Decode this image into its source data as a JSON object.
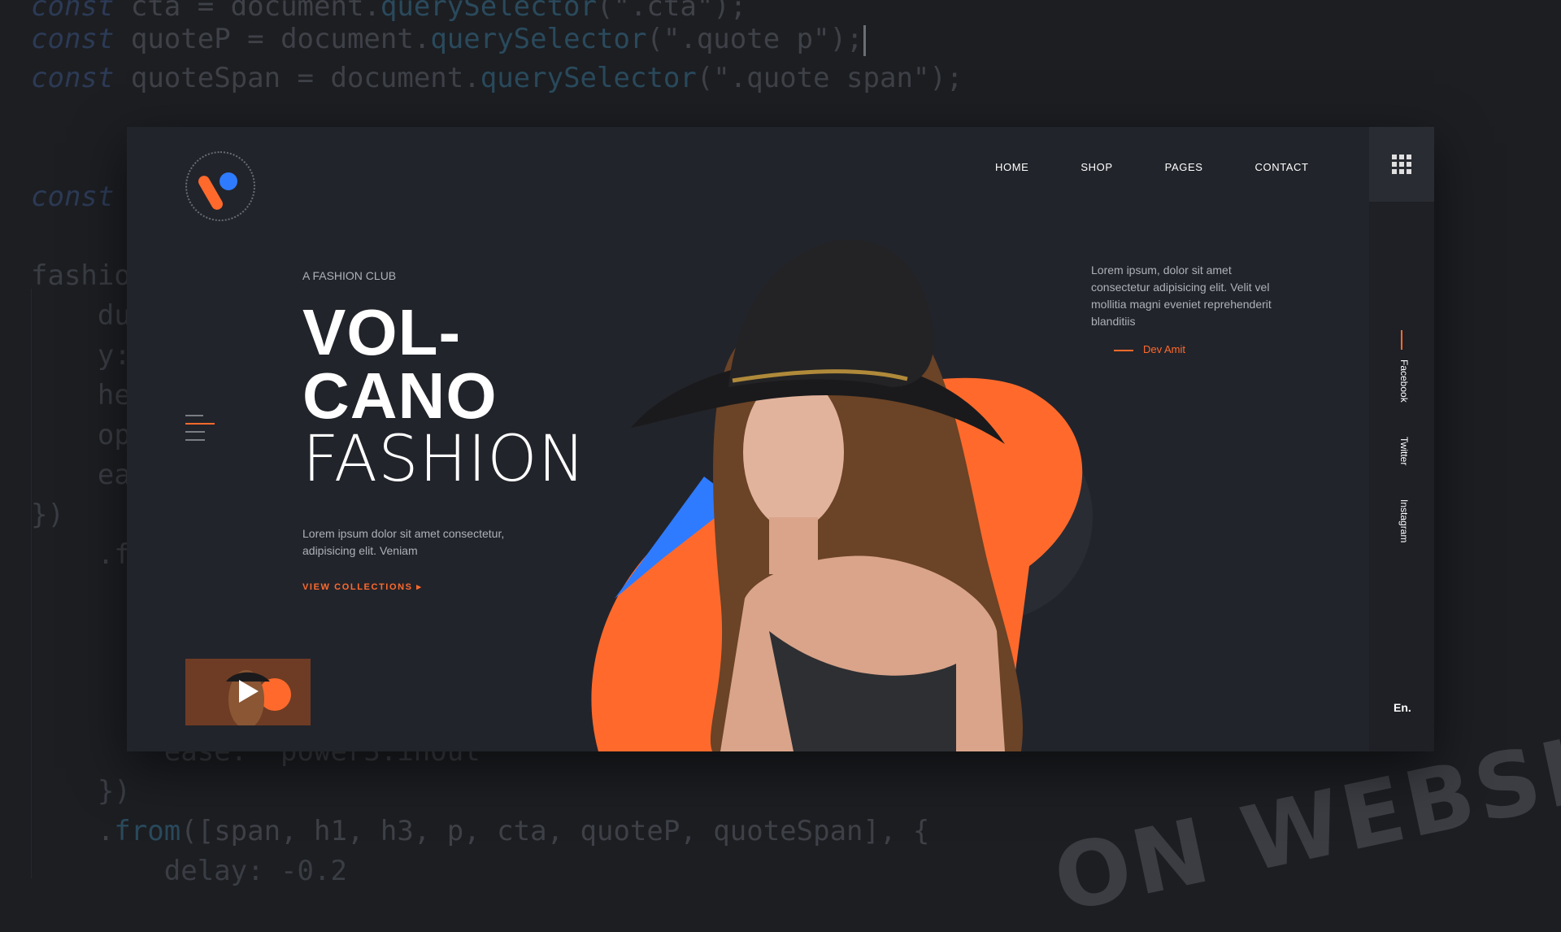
{
  "code": {
    "lines": [
      "const cta = document.querySelector(\".cta\");",
      "const quoteP = document.querySelector(\".quote p\");",
      "const quoteSpan = document.querySelector(\".quote span\");",
      "",
      "const",
      "",
      "fashio",
      "    du",
      "    y:",
      "    he",
      "    op",
      "    ea",
      "})",
      "    .f",
      "",
      "",
      "",
      "",
      "",
      "        ease: \"power3.inOut\"",
      "    })",
      "    .from([span, h1, h3, p, cta, quoteP, quoteSpan], {",
      "        delay: -0.2"
    ]
  },
  "watermark": "ON WEBSITE",
  "site": {
    "nav": [
      "HOME",
      "SHOP",
      "PAGES",
      "CONTACT"
    ],
    "eyebrow": "A FASHION CLUB",
    "headline": {
      "line1": "VOL-",
      "line2": "CANO",
      "line3": "FASHION"
    },
    "description": "Lorem ipsum dolor sit amet consectetur, adipisicing elit. Veniam",
    "cta": "VIEW COLLECTIONS ▸",
    "quote": "Lorem ipsum, dolor sit amet consectetur adipisicing elit. Velit vel mollitia magni eveniet reprehenderit blanditiis",
    "quote_author": "Dev Amit",
    "social": [
      "Facebook",
      "Twitter",
      "Instagram"
    ],
    "language": "En."
  },
  "colors": {
    "accent": "#ff6a2c",
    "blue": "#2f7bff",
    "bg": "#22242b"
  }
}
